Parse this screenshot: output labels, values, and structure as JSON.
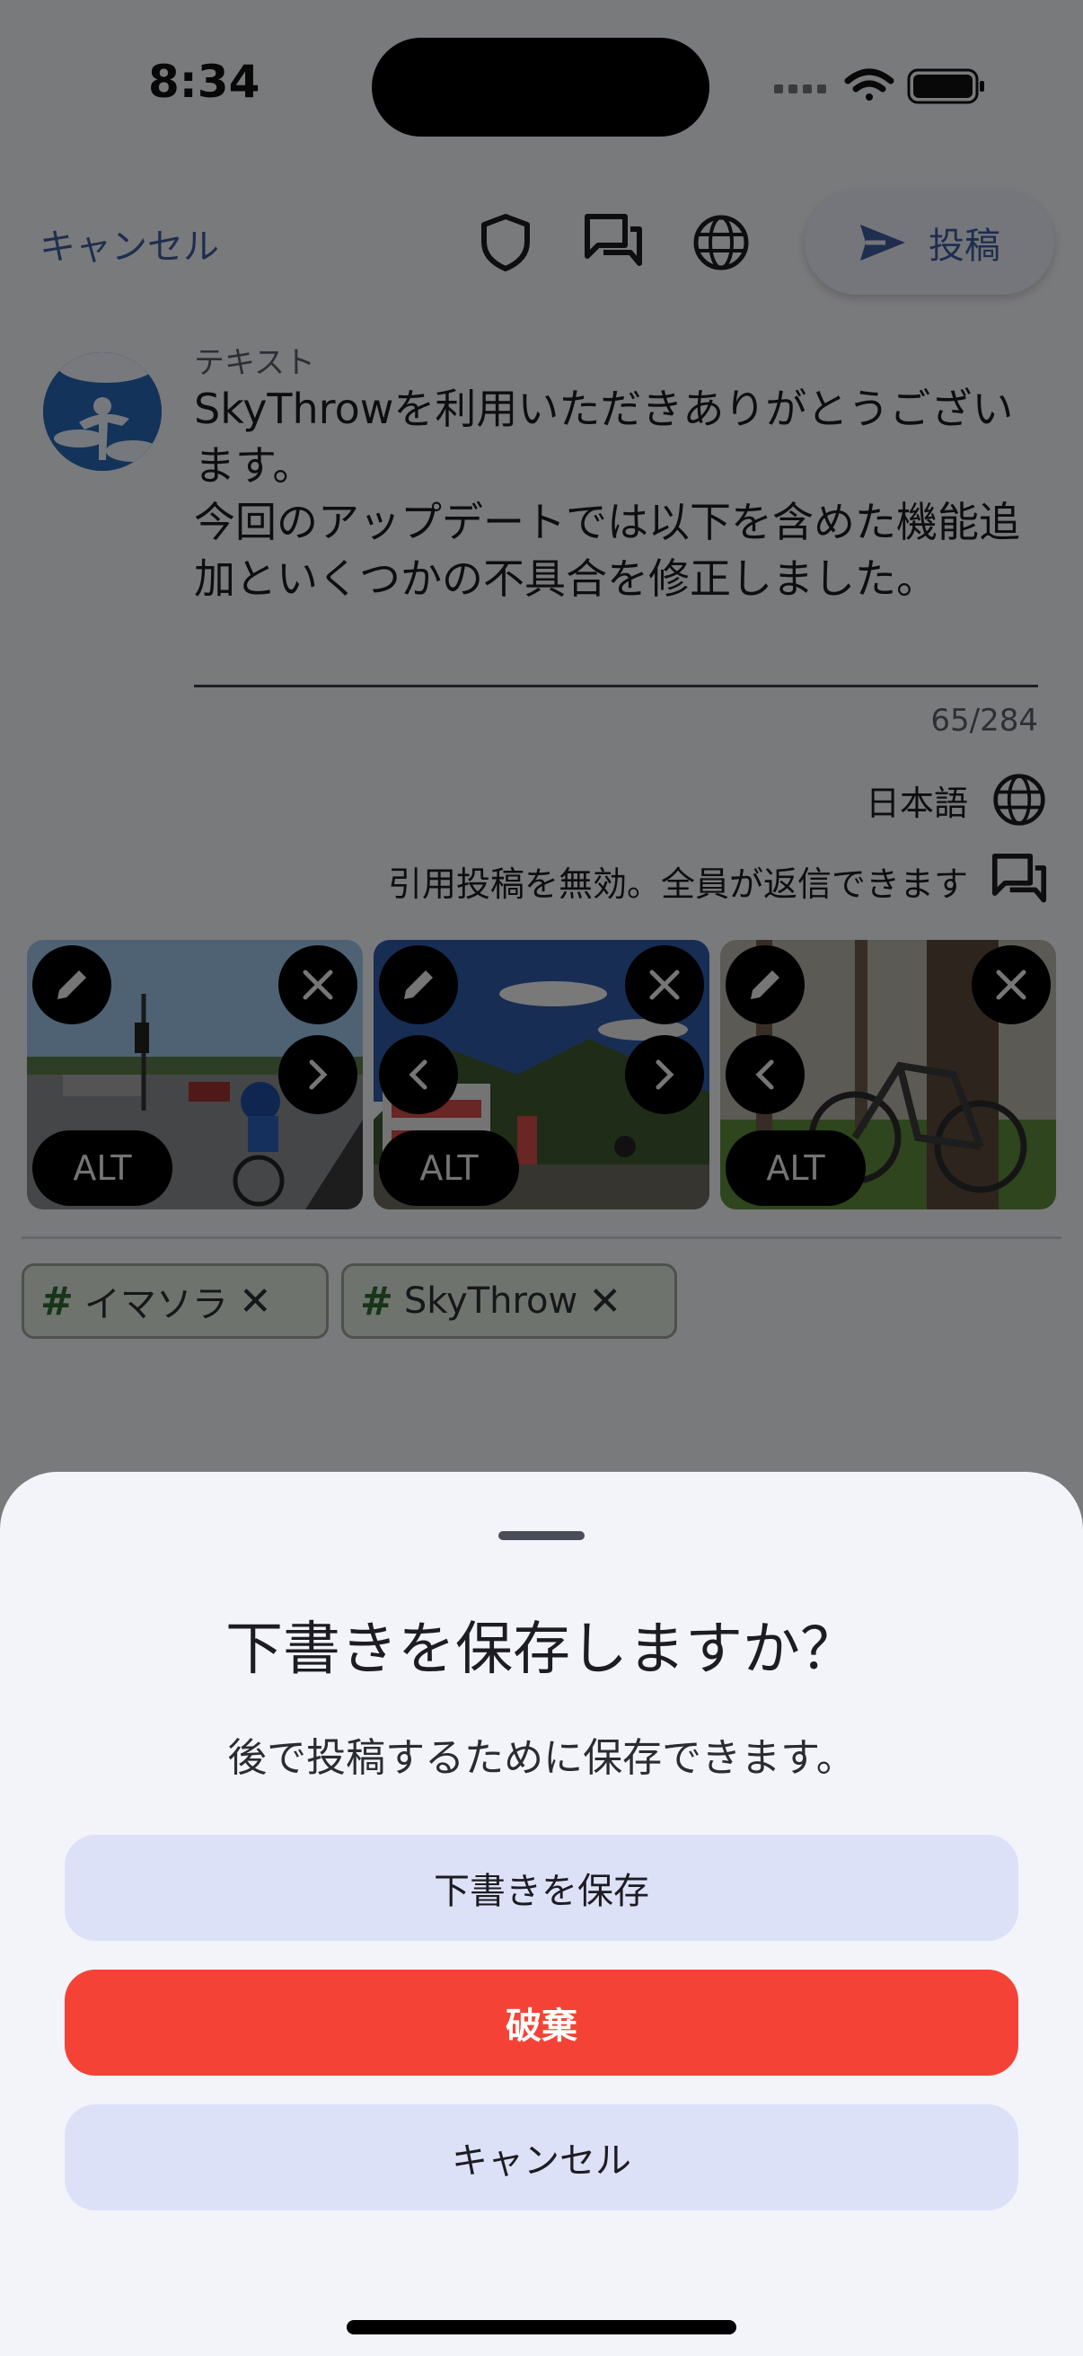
{
  "status_bar": {
    "time": "8:34"
  },
  "toolbar": {
    "cancel_label": "キャンセル",
    "post_label": "投稿",
    "icons": [
      "shield-icon",
      "threads-icon",
      "globe-icon",
      "send-icon"
    ]
  },
  "compose": {
    "field_label": "テキスト",
    "text": "SkyThrowを利用いただきありがとうございます。\n今回のアップデートでは以下を含めた機能追加といくつかの不具合を修正しました。",
    "char_count": "65/284",
    "language": "日本語",
    "reply_setting": "引用投稿を無効。全員が返信できます"
  },
  "attachments": [
    {
      "alt_label": "ALT",
      "subject": "cyclist-photo"
    },
    {
      "alt_label": "ALT",
      "subject": "event-tent-photo"
    },
    {
      "alt_label": "ALT",
      "subject": "bicycle-tree-photo"
    }
  ],
  "tags": [
    {
      "hash": "#",
      "label": "イマソラ",
      "remove": "✕"
    },
    {
      "hash": "#",
      "label": "SkyThrow",
      "remove": "✕"
    }
  ],
  "sheet": {
    "title": "下書きを保存しますか？",
    "subtitle": "後で投稿するために保存できます。",
    "save_label": "下書きを保存",
    "discard_label": "破棄",
    "cancel_label": "キャンセル"
  },
  "colors": {
    "accent": "#3f5d9e",
    "discard": "#f44336",
    "sheet_button": "#dde1f8",
    "tag_hash": "#2f6b35"
  }
}
